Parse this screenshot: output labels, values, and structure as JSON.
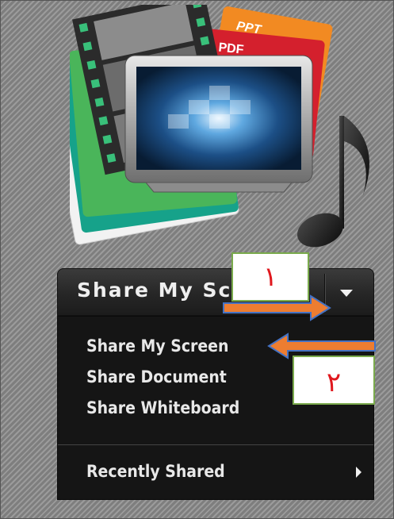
{
  "share_button": {
    "label": "Share My Screen"
  },
  "menu": {
    "items": [
      {
        "label": "Share My Screen"
      },
      {
        "label": "Share Document"
      },
      {
        "label": "Share Whiteboard"
      }
    ],
    "recent": {
      "label": "Recently Shared"
    }
  },
  "illustration": {
    "ppt_label": "PPT",
    "pdf_label": "PDF"
  },
  "callouts": {
    "step1": "١",
    "step2": "٢"
  },
  "colors": {
    "arrow": "#ed7d31",
    "arrow_outline": "#4472c4",
    "callout_border": "#7aaa4c",
    "callout_text": "#e0181e"
  },
  "icons": [
    "film-strip-icon",
    "monitor-icon",
    "music-note-icon",
    "dropdown-caret-icon",
    "submenu-arrow-icon"
  ]
}
